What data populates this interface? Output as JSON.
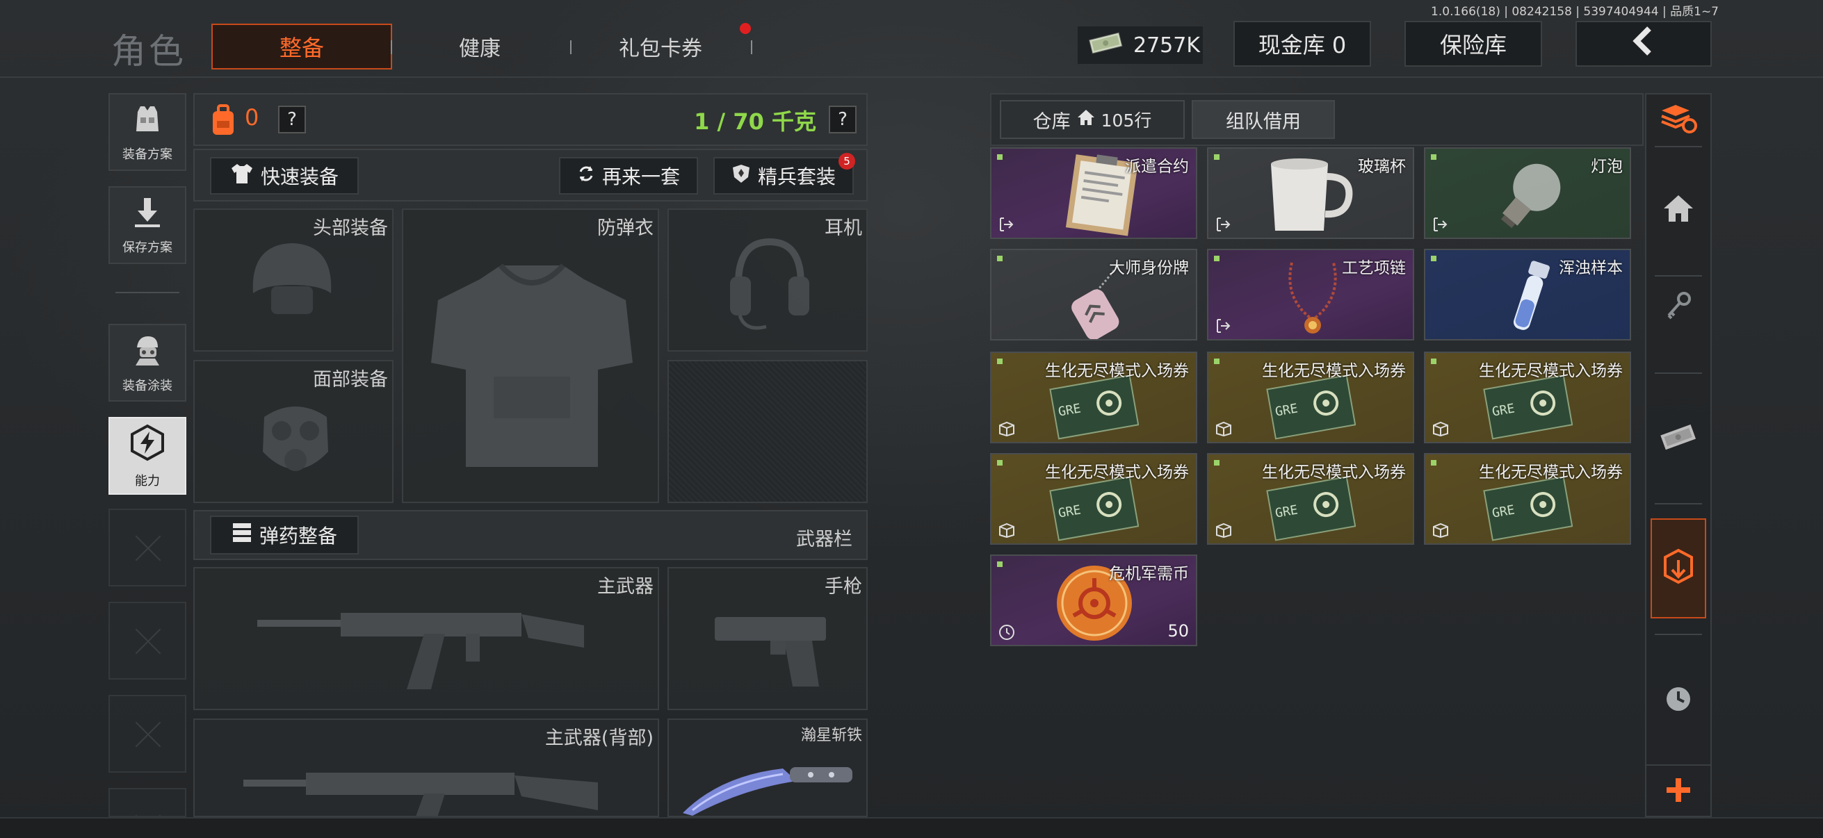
{
  "header": {
    "version": "1.0.166(18) | 08242158 | 5397404944 | 品质1~7",
    "role_title": "角色",
    "tabs": [
      {
        "label": "整备",
        "active": true
      },
      {
        "label": "健康",
        "active": false
      },
      {
        "label": "礼包卡券",
        "active": false,
        "notification": true
      }
    ],
    "currency_amount": "2757K",
    "cash_vault_label": "现金库 0",
    "insurance_label": "保险库",
    "back_icon": "chevron-left-icon"
  },
  "left_sidebar": {
    "items": [
      {
        "label": "装备方案",
        "icon": "vest-icon"
      },
      {
        "label": "保存方案",
        "icon": "download-icon"
      },
      {
        "label": "装备涂装",
        "icon": "soldier-icon"
      },
      {
        "label": "能力",
        "icon": "lightning-hex-icon",
        "active": true
      }
    ]
  },
  "equipment": {
    "backpack_count": "0",
    "weight": "1 / 70 千克",
    "help": "?",
    "quick_equip_label": "快速装备",
    "reequip_label": "再来一套",
    "elite_kit_label": "精兵套装",
    "elite_kit_badge": "5",
    "slots": {
      "head": "头部装备",
      "vest": "防弹衣",
      "headset": "耳机",
      "face": "面部装备"
    },
    "ammo_label": "弹药整备",
    "weapon_bar_label": "武器栏",
    "weapons": {
      "primary": "主武器",
      "pistol": "手枪",
      "primary_back": "主武器(背部)",
      "melee": "瀚星斩铁"
    }
  },
  "warehouse": {
    "tab_warehouse": "仓库",
    "tab_warehouse_rows": "105行",
    "tab_team_loan": "组队借用",
    "items": [
      {
        "name": "派遣合约",
        "rarity": "purple",
        "icon": "contract-icon"
      },
      {
        "name": "玻璃杯",
        "rarity": "gray",
        "icon": "mug-icon"
      },
      {
        "name": "灯泡",
        "rarity": "green",
        "icon": "lightbulb-icon"
      },
      {
        "name": "大师身份牌",
        "rarity": "gray",
        "icon": "dogtag-icon"
      },
      {
        "name": "工艺项链",
        "rarity": "purple",
        "icon": "necklace-icon"
      },
      {
        "name": "浑浊样本",
        "rarity": "blue",
        "icon": "vial-icon"
      },
      {
        "name": "生化无尽模式入场券",
        "rarity": "gold",
        "icon": "biohazard-ticket-icon"
      },
      {
        "name": "生化无尽模式入场券",
        "rarity": "gold",
        "icon": "biohazard-ticket-icon"
      },
      {
        "name": "生化无尽模式入场券",
        "rarity": "gold",
        "icon": "biohazard-ticket-icon"
      },
      {
        "name": "生化无尽模式入场券",
        "rarity": "gold",
        "icon": "biohazard-ticket-icon"
      },
      {
        "name": "生化无尽模式入场券",
        "rarity": "gold",
        "icon": "biohazard-ticket-icon"
      },
      {
        "name": "生化无尽模式入场券",
        "rarity": "gold",
        "icon": "biohazard-ticket-icon"
      },
      {
        "name": "危机军需币",
        "rarity": "purple",
        "icon": "biohazard-coin-icon",
        "count": "50"
      }
    ]
  },
  "right_rail": {
    "items": [
      "sort-refresh-icon",
      "home-icon",
      "key-icon",
      "cash-icon",
      "warehouse-export-icon",
      "clock-icon",
      "plus-icon"
    ]
  },
  "colors": {
    "accent": "#ff6a2a",
    "weight_green": "#8fd84a"
  }
}
